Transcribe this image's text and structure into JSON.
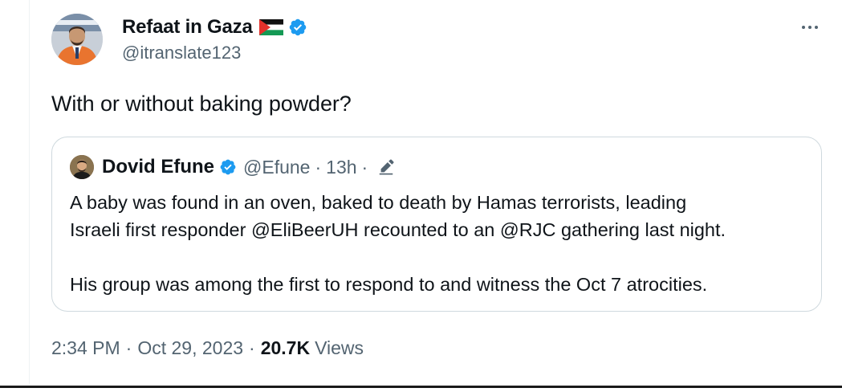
{
  "tweet": {
    "author": {
      "name": "Refaat in Gaza",
      "flag": "palestine-flag",
      "verified": true,
      "handle": "@itranslate123",
      "avatar_icon": "person-avatar"
    },
    "more_icon": "ellipsis-icon",
    "text": "With or without baking powder?",
    "quoted": {
      "name": "Dovid Efune",
      "verified": true,
      "handle": "@Efune",
      "dot": "·",
      "time": "13h",
      "edited_icon": "pencil-icon",
      "body": [
        "A baby was found in an oven, baked to death by Hamas terrorists, leading",
        "Israeli first responder @EliBeerUH recounted to an @RJC gathering last night.",
        "",
        "His group was among the first to respond to and witness the Oct 7 atrocities."
      ]
    },
    "meta": {
      "time": "2:34 PM",
      "dot": "·",
      "date": "Oct 29, 2023",
      "views_count": "20.7K",
      "views_label": "Views"
    }
  },
  "colors": {
    "text": "#0f1419",
    "secondary": "#536471",
    "verified": "#1d9bf0",
    "border": "#cfd9de"
  }
}
